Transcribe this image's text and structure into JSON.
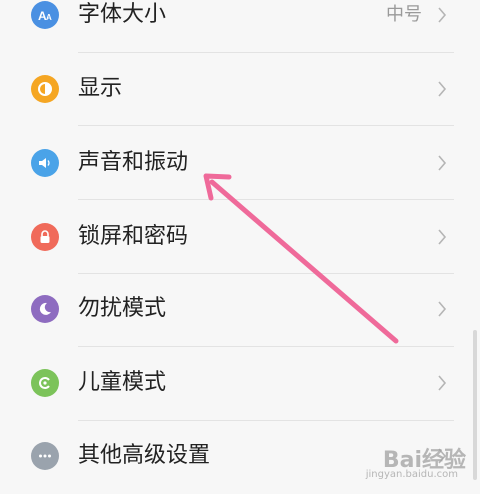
{
  "settings": {
    "items": [
      {
        "label": "字体大小",
        "value": "中号",
        "icon": "font-size-icon",
        "color": "#4a90e2"
      },
      {
        "label": "显示",
        "value": "",
        "icon": "display-icon",
        "color": "#f5a623"
      },
      {
        "label": "声音和振动",
        "value": "",
        "icon": "sound-icon",
        "color": "#4aa3e8"
      },
      {
        "label": "锁屏和密码",
        "value": "",
        "icon": "lock-icon",
        "color": "#f06a5a"
      },
      {
        "label": "勿扰模式",
        "value": "",
        "icon": "moon-icon",
        "color": "#8e6cc0"
      },
      {
        "label": "儿童模式",
        "value": "",
        "icon": "child-mode-icon",
        "color": "#7cc35a"
      },
      {
        "label": "其他高级设置",
        "value": "",
        "icon": "more-icon",
        "color": "#9aa3ad"
      }
    ]
  },
  "annotation": {
    "color": "#ef6a9a"
  },
  "watermark": {
    "text": "Bai经验",
    "sub": "jingyan.baidu.com"
  }
}
